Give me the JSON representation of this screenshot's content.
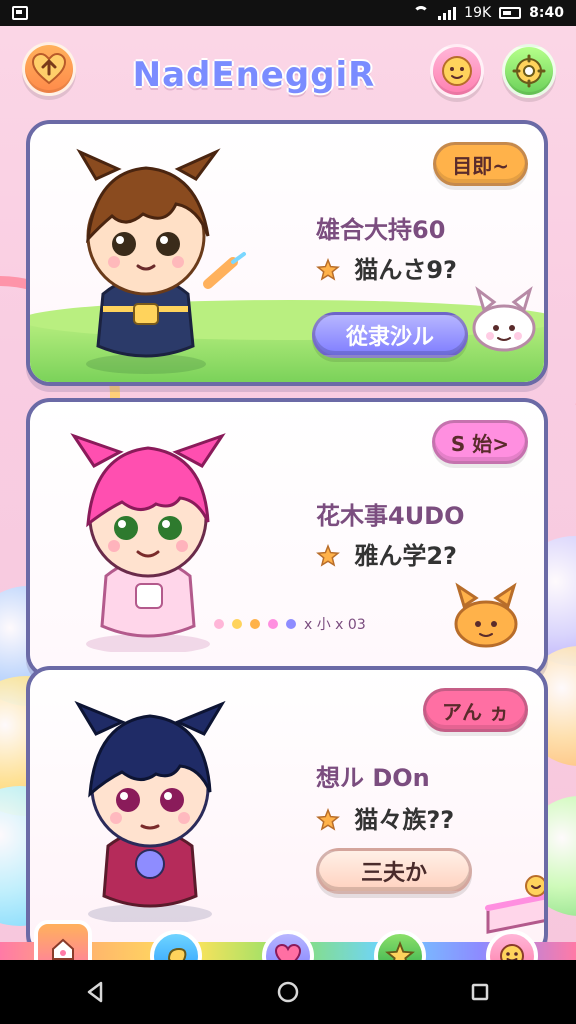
{
  "status_bar": {
    "battery_text": "19K",
    "time": "8:40"
  },
  "header": {
    "title": "NadEneggiR",
    "left_icon": "heart-badge-icon",
    "right_icons": [
      "bell-face-icon",
      "settings-gear-icon"
    ]
  },
  "cards": [
    {
      "pill_label": "目即~",
      "title": "雄合大持60",
      "subtitle": "猫んさ9?",
      "action_label": "從隶沙ル",
      "colors": {
        "pill": "#ffb24a",
        "action": "#8e8cff",
        "bg": "#ffffff"
      },
      "pet_icon": "white-bunny-cat-icon"
    },
    {
      "pill_label": "S 始>",
      "title": "花木事4UDO",
      "subtitle": "雅ん学2?",
      "dots_label": "ⅹ 小  ⅹ 03",
      "colors": {
        "pill": "#ff8fe0",
        "bg": "#ffffff"
      },
      "pet_icon": "orange-cat-icon"
    },
    {
      "pill_label": "アん ヵ",
      "title": "想ル DOn",
      "subtitle": "猫々族??",
      "action_label": "三夫か",
      "colors": {
        "pill": "#ff6fa3",
        "action": "#ffd9c9",
        "bg": "#ffffff"
      },
      "pet_icon": "cake-dessert-icon"
    }
  ],
  "bottom_nav": {
    "items": [
      {
        "name": "home",
        "icon": "home-icon"
      },
      {
        "name": "chat",
        "icon": "leaf-chat-icon"
      },
      {
        "name": "heart",
        "icon": "heart-icon"
      },
      {
        "name": "star",
        "icon": "star-icon"
      },
      {
        "name": "friends",
        "icon": "smiley-face-icon"
      }
    ]
  }
}
